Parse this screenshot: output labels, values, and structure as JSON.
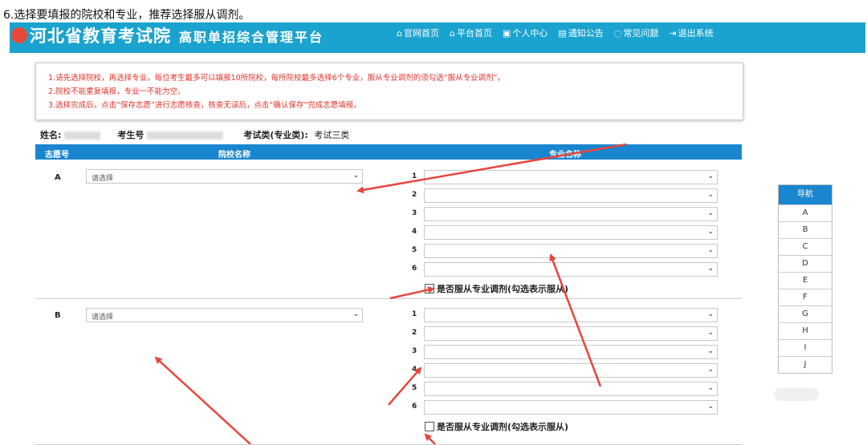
{
  "caption": "6.选择要填报的院校和专业，推荐选择服从调剂。",
  "header": {
    "org": "河北省教育考试院",
    "platform": "高职单招综合管理平台",
    "nav": [
      {
        "icon": "home-icon",
        "glyph": "⌂",
        "label": "官网首页"
      },
      {
        "icon": "home-icon",
        "glyph": "⌂",
        "label": "平台首页"
      },
      {
        "icon": "user-card-icon",
        "glyph": "▣",
        "label": "个人中心"
      },
      {
        "icon": "notice-icon",
        "glyph": "▤",
        "label": "通知公告"
      },
      {
        "icon": "chat-icon",
        "glyph": "◌",
        "label": "常见问题"
      },
      {
        "icon": "logout-icon",
        "glyph": "⇥",
        "label": "退出系统"
      }
    ]
  },
  "notice": [
    "1.请先选择院校，再选择专业，每位考生最多可以填报10所院校，每所院校最多选择6个专业，服从专业调剂的须勾选“服从专业调剂”。",
    "2.院校不能重复填报，专业一不能为空。",
    "3.选择完成后，点击“保存志愿”进行志愿核查，核查无误后，点击“确认保存”完成志愿填报。"
  ],
  "info": {
    "name_label": "姓名:",
    "exam_no_label": "考生号",
    "category_label": "考试类(专业类):",
    "category_value": "考试三类"
  },
  "table": {
    "col_volunteer": "志愿号",
    "col_school": "院校名称",
    "col_major": "专业名称"
  },
  "groups": [
    {
      "letter": "A",
      "school_placeholder": "请选择",
      "majors": [
        "1",
        "2",
        "3",
        "4",
        "5",
        "6"
      ],
      "adjust_label": "是否服从专业调剂(勾选表示服从)"
    },
    {
      "letter": "B",
      "school_placeholder": "请选择",
      "majors": [
        "1",
        "2",
        "3",
        "4",
        "5",
        "6"
      ],
      "adjust_label": "是否服从专业调剂(勾选表示服从)"
    }
  ],
  "side_nav": {
    "title": "导航",
    "items": [
      "A",
      "B",
      "C",
      "D",
      "E",
      "F",
      "G",
      "H",
      "I",
      "J"
    ]
  },
  "colors": {
    "header_bg": "#1ba3cf",
    "table_header_bg": "#1a86cf",
    "notice_text": "#e0312a",
    "annotation_arrow": "#e8453c"
  }
}
